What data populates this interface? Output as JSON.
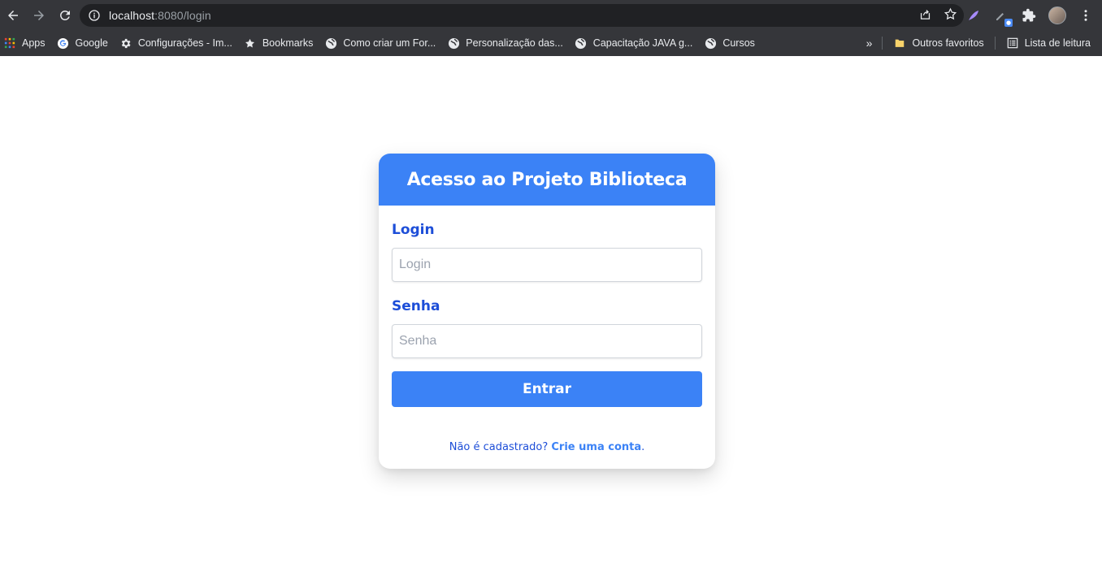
{
  "browser": {
    "url_host": "localhost",
    "url_rest": ":8080/login",
    "bookmarks": [
      {
        "label": "Apps",
        "icon": "apps-grid-icon"
      },
      {
        "label": "Google",
        "icon": "google-icon"
      },
      {
        "label": "Configurações - Im...",
        "icon": "gear-icon"
      },
      {
        "label": "Bookmarks",
        "icon": "star-icon"
      },
      {
        "label": "Como criar um For...",
        "icon": "globe-icon"
      },
      {
        "label": "Personalização das...",
        "icon": "globe-icon"
      },
      {
        "label": "Capacitação JAVA g...",
        "icon": "globe-icon"
      },
      {
        "label": "Cursos",
        "icon": "globe-icon"
      }
    ],
    "overflow_label": "»",
    "other_favorites": "Outros favoritos",
    "reading_list": "Lista de leitura"
  },
  "login_card": {
    "title": "Acesso ao Projeto Biblioteca",
    "login_label": "Login",
    "login_placeholder": "Login",
    "password_label": "Senha",
    "password_placeholder": "Senha",
    "submit_label": "Entrar",
    "signup_prompt": "Não é cadastrado? ",
    "signup_link": "Crie uma conta",
    "signup_suffix": "."
  },
  "colors": {
    "primary": "#3b82f6",
    "label": "#1d4ed8",
    "chrome_bg": "#35363a"
  }
}
